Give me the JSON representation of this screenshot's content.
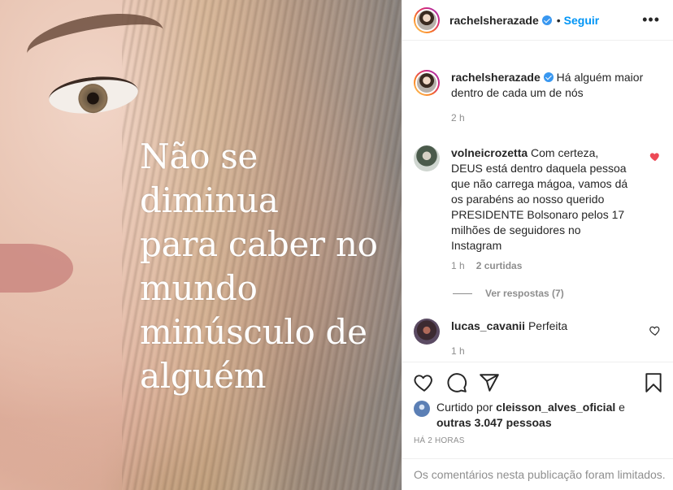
{
  "post": {
    "quote_lines": [
      "Não se",
      "diminua",
      "para caber no",
      "mundo",
      "minúsculo de",
      "alguém"
    ]
  },
  "header": {
    "username": "rachelsherazade",
    "separator": "•",
    "follow_label": "Seguir",
    "more_label": "•••"
  },
  "caption": {
    "username": "rachelsherazade",
    "text": "Há alguém maior dentro de cada um de nós",
    "time": "2 h"
  },
  "comments": [
    {
      "username": "volneicrozetta",
      "text": "Com certeza, DEUS está dentro daquela pessoa que não carrega mágoa, vamos dá os parabéns ao nosso querido PRESIDENTE Bolsonaro pelos 17 milhões de seguidores no Instagram",
      "time": "1 h",
      "likes": "2 curtidas",
      "liked": true,
      "replies": "Ver respostas (7)"
    },
    {
      "username": "lucas_cavanii",
      "text": "Perfeita",
      "time": "1 h",
      "liked": false
    }
  ],
  "likes": {
    "prefix": "Curtido por",
    "user": "cleisson_alves_oficial",
    "joiner": "e",
    "others": "outras 3.047 pessoas"
  },
  "timestamp": "HÁ 2 HORAS",
  "limited_notice": "Os comentários nesta publicação foram limitados.",
  "colors": {
    "accent": "#0095f6",
    "like_red": "#ed4956",
    "muted": "#8e8e8e",
    "text": "#262626"
  },
  "icons": [
    "heart-icon",
    "comment-icon",
    "share-icon",
    "bookmark-icon",
    "verified-icon",
    "more-icon"
  ]
}
